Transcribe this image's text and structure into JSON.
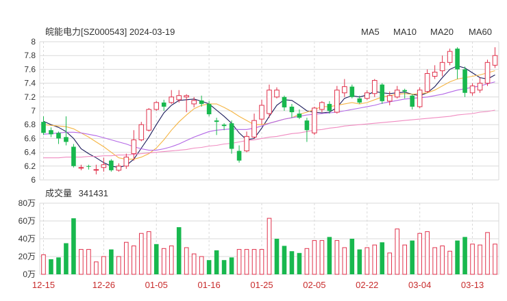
{
  "header": {
    "title": "皖能电力[SZ000543] 2024-03-19"
  },
  "legend": [
    {
      "label": "MA5",
      "color": "#1a1a5a"
    },
    {
      "label": "MA10",
      "color": "#f5b544"
    },
    {
      "label": "MA20",
      "color": "#b366e6"
    },
    {
      "label": "MA60",
      "color": "#f08ac0"
    }
  ],
  "volume_header": {
    "label": "成交量",
    "value": "341431"
  },
  "colors": {
    "up": "#e0304a",
    "down": "#18b84e",
    "grid": "#d9d9d9"
  },
  "chart_data": [
    {
      "type": "candlestick",
      "price_ticks": [
        "8",
        "7.8",
        "7.6",
        "7.4",
        "7.2",
        "7",
        "6.8",
        "6.6",
        "6.4",
        "6.2",
        "6"
      ],
      "ylim": [
        6,
        8
      ],
      "x_labels": [
        {
          "index": 0,
          "label": "12-15"
        },
        {
          "index": 8,
          "label": "12-26"
        },
        {
          "index": 15,
          "label": "01-05"
        },
        {
          "index": 22,
          "label": "01-16"
        },
        {
          "index": 29,
          "label": "01-25"
        },
        {
          "index": 36,
          "label": "02-05"
        },
        {
          "index": 43,
          "label": "02-22"
        },
        {
          "index": 50,
          "label": "03-04"
        },
        {
          "index": 57,
          "label": "03-13"
        }
      ],
      "candles": [
        [
          6.84,
          6.68,
          6.92,
          6.65
        ],
        [
          6.72,
          6.66,
          6.76,
          6.62
        ],
        [
          6.68,
          6.6,
          6.7,
          6.52
        ],
        [
          6.62,
          6.55,
          6.92,
          6.5
        ],
        [
          6.48,
          6.2,
          6.52,
          6.18
        ],
        [
          6.18,
          6.18,
          6.22,
          6.14
        ],
        [
          6.2,
          6.19,
          6.22,
          6.15
        ],
        [
          6.14,
          6.15,
          6.22,
          6.08
        ],
        [
          6.18,
          6.22,
          6.32,
          6.12
        ],
        [
          6.28,
          6.14,
          6.3,
          6.12
        ],
        [
          6.14,
          6.2,
          6.24,
          6.12
        ],
        [
          6.2,
          6.33,
          6.38,
          6.16
        ],
        [
          6.38,
          6.58,
          6.72,
          6.28
        ],
        [
          6.58,
          6.8,
          6.84,
          6.56
        ],
        [
          6.72,
          7.02,
          7.04,
          6.7
        ],
        [
          7.02,
          7.12,
          7.14,
          7.0
        ],
        [
          7.12,
          7.06,
          7.16,
          7.0
        ],
        [
          7.12,
          7.2,
          7.3,
          7.1
        ],
        [
          7.16,
          7.22,
          7.3,
          7.12
        ],
        [
          7.2,
          7.22,
          7.24,
          6.98
        ],
        [
          7.1,
          7.15,
          7.2,
          7.05
        ],
        [
          7.15,
          7.1,
          7.22,
          7.06
        ],
        [
          7.1,
          6.95,
          7.14,
          6.92
        ],
        [
          6.86,
          6.84,
          6.9,
          6.65
        ],
        [
          6.8,
          6.78,
          6.82,
          6.72
        ],
        [
          6.82,
          6.45,
          6.86,
          6.38
        ],
        [
          6.42,
          6.28,
          6.5,
          6.25
        ],
        [
          6.42,
          6.63,
          6.7,
          6.4
        ],
        [
          6.62,
          6.86,
          6.96,
          6.6
        ],
        [
          6.88,
          7.08,
          7.16,
          6.8
        ],
        [
          6.96,
          7.3,
          7.38,
          6.9
        ],
        [
          7.2,
          7.3,
          7.34,
          7.18
        ],
        [
          7.2,
          7.05,
          7.22,
          7.0
        ],
        [
          7.06,
          6.98,
          7.1,
          6.9
        ],
        [
          6.96,
          6.9,
          7.02,
          6.88
        ],
        [
          6.86,
          6.72,
          6.9,
          6.55
        ],
        [
          6.68,
          7.04,
          7.06,
          6.65
        ],
        [
          7.02,
          7.12,
          7.14,
          6.98
        ],
        [
          7.1,
          7.0,
          7.14,
          6.96
        ],
        [
          6.98,
          7.3,
          7.36,
          6.96
        ],
        [
          7.26,
          7.35,
          7.46,
          7.2
        ],
        [
          7.35,
          7.2,
          7.38,
          7.18
        ],
        [
          7.18,
          7.12,
          7.22,
          7.1
        ],
        [
          7.18,
          7.26,
          7.3,
          7.16
        ],
        [
          7.25,
          7.44,
          7.46,
          7.2
        ],
        [
          7.38,
          7.14,
          7.4,
          7.1
        ],
        [
          7.14,
          7.22,
          7.28,
          7.08
        ],
        [
          7.2,
          7.3,
          7.36,
          7.18
        ],
        [
          7.3,
          7.28,
          7.32,
          7.18
        ],
        [
          7.22,
          7.06,
          7.24,
          7.02
        ],
        [
          7.06,
          7.3,
          7.34,
          7.04
        ],
        [
          7.28,
          7.54,
          7.6,
          7.26
        ],
        [
          7.5,
          7.56,
          7.66,
          7.46
        ],
        [
          7.58,
          7.7,
          7.8,
          7.5
        ],
        [
          7.7,
          7.86,
          7.9,
          7.66
        ],
        [
          7.9,
          7.6,
          7.92,
          7.46
        ],
        [
          7.6,
          7.26,
          7.64,
          7.2
        ],
        [
          7.26,
          7.36,
          7.4,
          7.22
        ],
        [
          7.3,
          7.4,
          7.48,
          7.26
        ],
        [
          7.4,
          7.7,
          7.74,
          7.36
        ],
        [
          7.66,
          7.8,
          7.92,
          7.62
        ]
      ],
      "ma_series": [
        {
          "name": "MA5",
          "values": [
            6.85,
            6.8,
            6.76,
            6.7,
            6.6,
            6.45,
            6.38,
            6.32,
            6.25,
            6.2,
            6.18,
            6.21,
            6.3,
            6.46,
            6.62,
            6.8,
            6.97,
            7.08,
            7.15,
            7.16,
            7.17,
            7.14,
            7.1,
            7.01,
            6.92,
            6.82,
            6.68,
            6.58,
            6.6,
            6.75,
            6.92,
            7.08,
            7.16,
            7.15,
            7.08,
            7.0,
            6.98,
            6.97,
            6.98,
            7.05,
            7.18,
            7.22,
            7.2,
            7.23,
            7.28,
            7.26,
            7.25,
            7.26,
            7.27,
            7.24,
            7.22,
            7.26,
            7.35,
            7.48,
            7.6,
            7.65,
            7.62,
            7.55,
            7.48,
            7.46,
            7.52
          ]
        },
        {
          "name": "MA10",
          "values": [
            6.8,
            6.79,
            6.78,
            6.77,
            6.74,
            6.68,
            6.62,
            6.55,
            6.48,
            6.4,
            6.32,
            6.3,
            6.3,
            6.33,
            6.38,
            6.46,
            6.58,
            6.72,
            6.84,
            6.94,
            7.03,
            7.08,
            7.1,
            7.1,
            7.05,
            6.99,
            6.92,
            6.86,
            6.8,
            6.8,
            6.82,
            6.85,
            6.88,
            6.9,
            6.95,
            6.98,
            7.02,
            7.06,
            7.06,
            7.08,
            7.1,
            7.12,
            7.1,
            7.12,
            7.16,
            7.2,
            7.22,
            7.24,
            7.25,
            7.24,
            7.25,
            7.26,
            7.3,
            7.36,
            7.42,
            7.46,
            7.48,
            7.5,
            7.52,
            7.55,
            7.58
          ]
        },
        {
          "name": "MA20",
          "values": [
            6.66,
            6.67,
            6.68,
            6.69,
            6.69,
            6.68,
            6.66,
            6.64,
            6.61,
            6.58,
            6.55,
            6.52,
            6.48,
            6.45,
            6.43,
            6.43,
            6.45,
            6.48,
            6.52,
            6.57,
            6.62,
            6.66,
            6.7,
            6.72,
            6.73,
            6.74,
            6.73,
            6.73,
            6.75,
            6.78,
            6.82,
            6.85,
            6.88,
            6.9,
            6.92,
            6.94,
            6.95,
            6.96,
            6.97,
            6.98,
            7.0,
            7.02,
            7.04,
            7.06,
            7.08,
            7.11,
            7.13,
            7.15,
            7.17,
            7.18,
            7.19,
            7.2,
            7.22,
            7.24,
            7.27,
            7.3,
            7.32,
            7.34,
            7.36,
            7.39,
            7.42
          ]
        },
        {
          "name": "MA60",
          "values": [
            6.32,
            6.32,
            6.32,
            6.33,
            6.33,
            6.33,
            6.34,
            6.34,
            6.35,
            6.35,
            6.36,
            6.36,
            6.37,
            6.38,
            6.39,
            6.4,
            6.41,
            6.42,
            6.43,
            6.44,
            6.46,
            6.47,
            6.49,
            6.5,
            6.52,
            6.53,
            6.55,
            6.57,
            6.58,
            6.6,
            6.62,
            6.63,
            6.65,
            6.67,
            6.68,
            6.7,
            6.72,
            6.73,
            6.75,
            6.76,
            6.78,
            6.79,
            6.8,
            6.81,
            6.82,
            6.83,
            6.84,
            6.85,
            6.86,
            6.87,
            6.88,
            6.89,
            6.9,
            6.91,
            6.92,
            6.94,
            6.95,
            6.96,
            6.98,
            6.99,
            7.01
          ]
        }
      ]
    },
    {
      "type": "bar",
      "title": "成交量",
      "y_ticks": [
        "80万",
        "60万",
        "40万",
        "20万",
        "0万"
      ],
      "ylim": [
        0,
        80
      ],
      "unit": "万",
      "values": [
        22,
        17,
        19,
        35,
        63,
        28,
        28,
        14,
        20,
        28,
        20,
        36,
        32,
        46,
        48,
        34,
        29,
        32,
        53,
        30,
        23,
        20,
        16,
        27,
        16,
        19,
        28,
        28,
        28,
        28,
        63,
        40,
        32,
        26,
        24,
        29,
        38,
        38,
        42,
        38,
        30,
        40,
        28,
        30,
        33,
        36,
        24,
        51,
        33,
        38,
        46,
        48,
        30,
        32,
        26,
        38,
        42,
        34,
        33,
        47,
        34
      ],
      "up": [
        1,
        0,
        0,
        0,
        0,
        1,
        1,
        1,
        1,
        0,
        1,
        1,
        1,
        1,
        1,
        0,
        1,
        1,
        0,
        1,
        1,
        1,
        0,
        0,
        0,
        0,
        1,
        1,
        1,
        1,
        1,
        0,
        0,
        0,
        0,
        1,
        1,
        1,
        0,
        1,
        1,
        0,
        0,
        1,
        1,
        0,
        1,
        1,
        1,
        0,
        1,
        1,
        1,
        1,
        1,
        0,
        0,
        1,
        1,
        1,
        1
      ]
    }
  ]
}
